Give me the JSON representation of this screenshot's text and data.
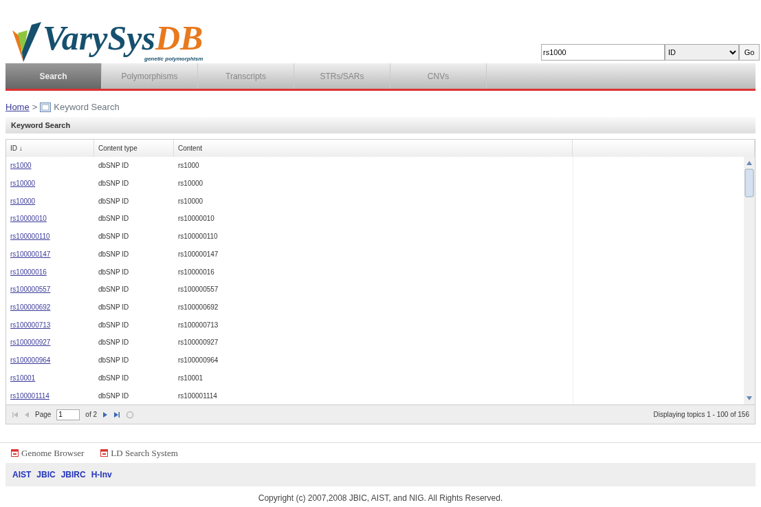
{
  "logo": {
    "name": "VarySys",
    "suffix": "DB",
    "tagline": "genetic polymorphism"
  },
  "search": {
    "value": "rs1000",
    "type": "ID",
    "button": "Go"
  },
  "tabs": [
    {
      "label": "Search",
      "selected": true
    },
    {
      "label": "Polymorphisms",
      "selected": false
    },
    {
      "label": "Transcripts",
      "selected": false
    },
    {
      "label": "STRs/SARs",
      "selected": false
    },
    {
      "label": "CNVs",
      "selected": false
    }
  ],
  "breadcrumb": {
    "home": "Home",
    "separator": ">",
    "current": "Keyword Search"
  },
  "panel": {
    "title": "Keyword Search"
  },
  "table": {
    "columns": [
      "ID",
      "Content type",
      "Content"
    ],
    "sort_indicator": "↓",
    "rows": [
      {
        "id": "rs1000",
        "type": "dbSNP ID",
        "content": "rs1000"
      },
      {
        "id": "rs10000",
        "type": "dbSNP ID",
        "content": "rs10000"
      },
      {
        "id": "rs10000",
        "type": "dbSNP ID",
        "content": "rs10000"
      },
      {
        "id": "rs10000010",
        "type": "dbSNP ID",
        "content": "rs10000010"
      },
      {
        "id": "rs100000110",
        "type": "dbSNP ID",
        "content": "rs100000110"
      },
      {
        "id": "rs100000147",
        "type": "dbSNP ID",
        "content": "rs100000147"
      },
      {
        "id": "rs10000016",
        "type": "dbSNP ID",
        "content": "rs10000016"
      },
      {
        "id": "rs100000557",
        "type": "dbSNP ID",
        "content": "rs100000557"
      },
      {
        "id": "rs100000692",
        "type": "dbSNP ID",
        "content": "rs100000692"
      },
      {
        "id": "rs100000713",
        "type": "dbSNP ID",
        "content": "rs100000713"
      },
      {
        "id": "rs100000927",
        "type": "dbSNP ID",
        "content": "rs100000927"
      },
      {
        "id": "rs100000964",
        "type": "dbSNP ID",
        "content": "rs100000964"
      },
      {
        "id": "rs10001",
        "type": "dbSNP ID",
        "content": "rs10001"
      },
      {
        "id": "rs100001114",
        "type": "dbSNP ID",
        "content": "rs100001114"
      }
    ]
  },
  "pager": {
    "page_label": "Page",
    "page": "1",
    "of": "of 2",
    "summary": "Displaying topics 1 - 100 of 156"
  },
  "tools": [
    "Genome Browser",
    "LD Search System"
  ],
  "partners": [
    "AIST",
    "JBIC",
    "JBIRC",
    "H-Inv"
  ],
  "copyright": "Copyright (c) 2007,2008 JBIC, AIST, and NIG. All Rights Reserved."
}
